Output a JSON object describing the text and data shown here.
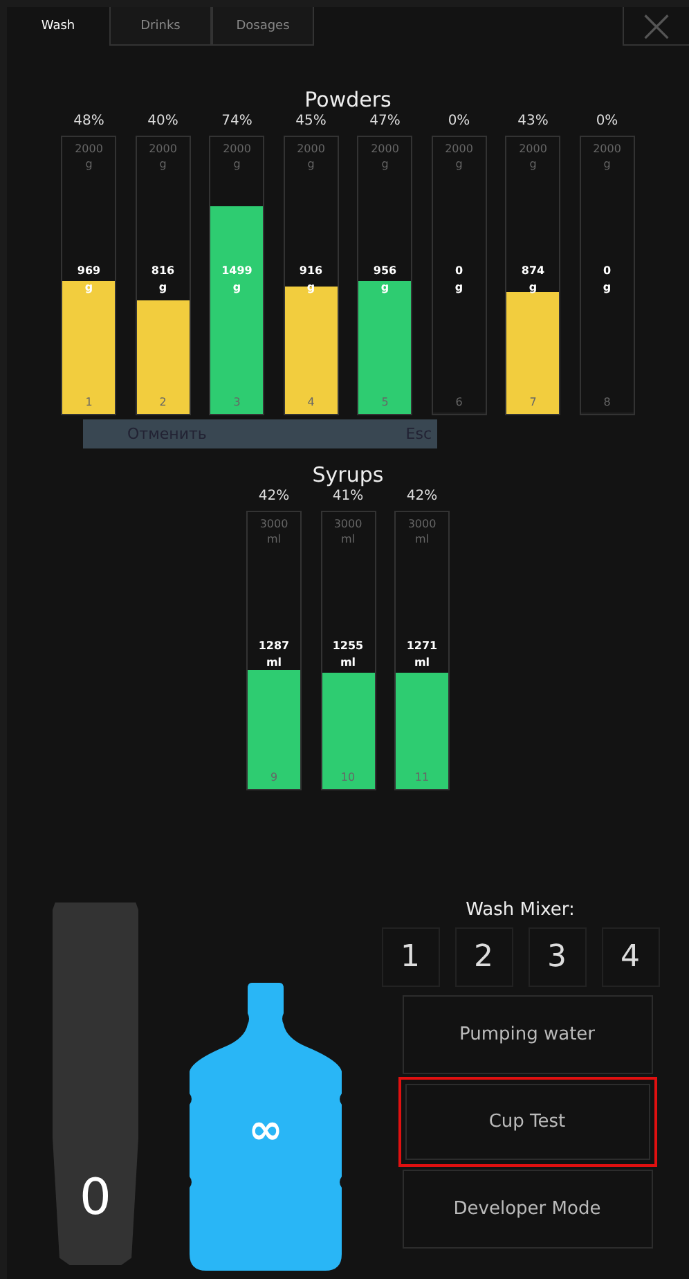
{
  "tabs": [
    {
      "label": "Wash",
      "selected": true
    },
    {
      "label": "Drinks",
      "selected": false
    },
    {
      "label": "Dosages",
      "selected": false
    }
  ],
  "close_button": {
    "label": "×"
  },
  "powders": {
    "title": "Powders",
    "tanks": [
      {
        "percent": "48%",
        "capacity": "2000",
        "capacity_unit": "g",
        "amount": "969",
        "amount_unit": "g",
        "index": "1",
        "level": 0.48,
        "color": "#f2cd3e"
      },
      {
        "percent": "40%",
        "capacity": "2000",
        "capacity_unit": "g",
        "amount": "816",
        "amount_unit": "g",
        "index": "2",
        "level": 0.41,
        "color": "#f2cd3e"
      },
      {
        "percent": "74%",
        "capacity": "2000",
        "capacity_unit": "g",
        "amount": "1499",
        "amount_unit": "g",
        "index": "3",
        "level": 0.75,
        "color": "#2ecc71"
      },
      {
        "percent": "45%",
        "capacity": "2000",
        "capacity_unit": "g",
        "amount": "916",
        "amount_unit": "g",
        "index": "4",
        "level": 0.46,
        "color": "#f2cd3e"
      },
      {
        "percent": "47%",
        "capacity": "2000",
        "capacity_unit": "g",
        "amount": "956",
        "amount_unit": "g",
        "index": "5",
        "level": 0.48,
        "color": "#2ecc71"
      },
      {
        "percent": "0%",
        "capacity": "2000",
        "capacity_unit": "g",
        "amount": "0",
        "amount_unit": "g",
        "index": "6",
        "level": 0
      },
      {
        "percent": "43%",
        "capacity": "2000",
        "capacity_unit": "g",
        "amount": "874",
        "amount_unit": "g",
        "index": "7",
        "level": 0.44,
        "color": "#f2cd3e"
      },
      {
        "percent": "0%",
        "capacity": "2000",
        "capacity_unit": "g",
        "amount": "0",
        "amount_unit": "g",
        "index": "8",
        "level": 0
      }
    ]
  },
  "syrups": {
    "title": "Syrups",
    "tanks": [
      {
        "percent": "42%",
        "capacity": "3000",
        "capacity_unit": "ml",
        "amount": "1287",
        "amount_unit": "ml",
        "index": "9",
        "level": 0.43,
        "color": "#2ecc71"
      },
      {
        "percent": "41%",
        "capacity": "3000",
        "capacity_unit": "ml",
        "amount": "1255",
        "amount_unit": "ml",
        "index": "10",
        "level": 0.42,
        "color": "#2ecc71"
      },
      {
        "percent": "42%",
        "capacity": "3000",
        "capacity_unit": "ml",
        "amount": "1271",
        "amount_unit": "ml",
        "index": "11",
        "level": 0.42,
        "color": "#2ecc71"
      }
    ]
  },
  "tooltip": {
    "action": "Отменить",
    "shortcut": "Esc"
  },
  "cups": {
    "count": "0"
  },
  "water": {
    "amount": "∞"
  },
  "wash_mixer": {
    "title": "Wash Mixer:",
    "buttons": [
      "1",
      "2",
      "3",
      "4"
    ]
  },
  "actions": [
    {
      "label": "Pumping water",
      "highlighted": false
    },
    {
      "label": "Cup Test",
      "highlighted": true
    },
    {
      "label": "Developer Mode",
      "highlighted": false
    }
  ]
}
